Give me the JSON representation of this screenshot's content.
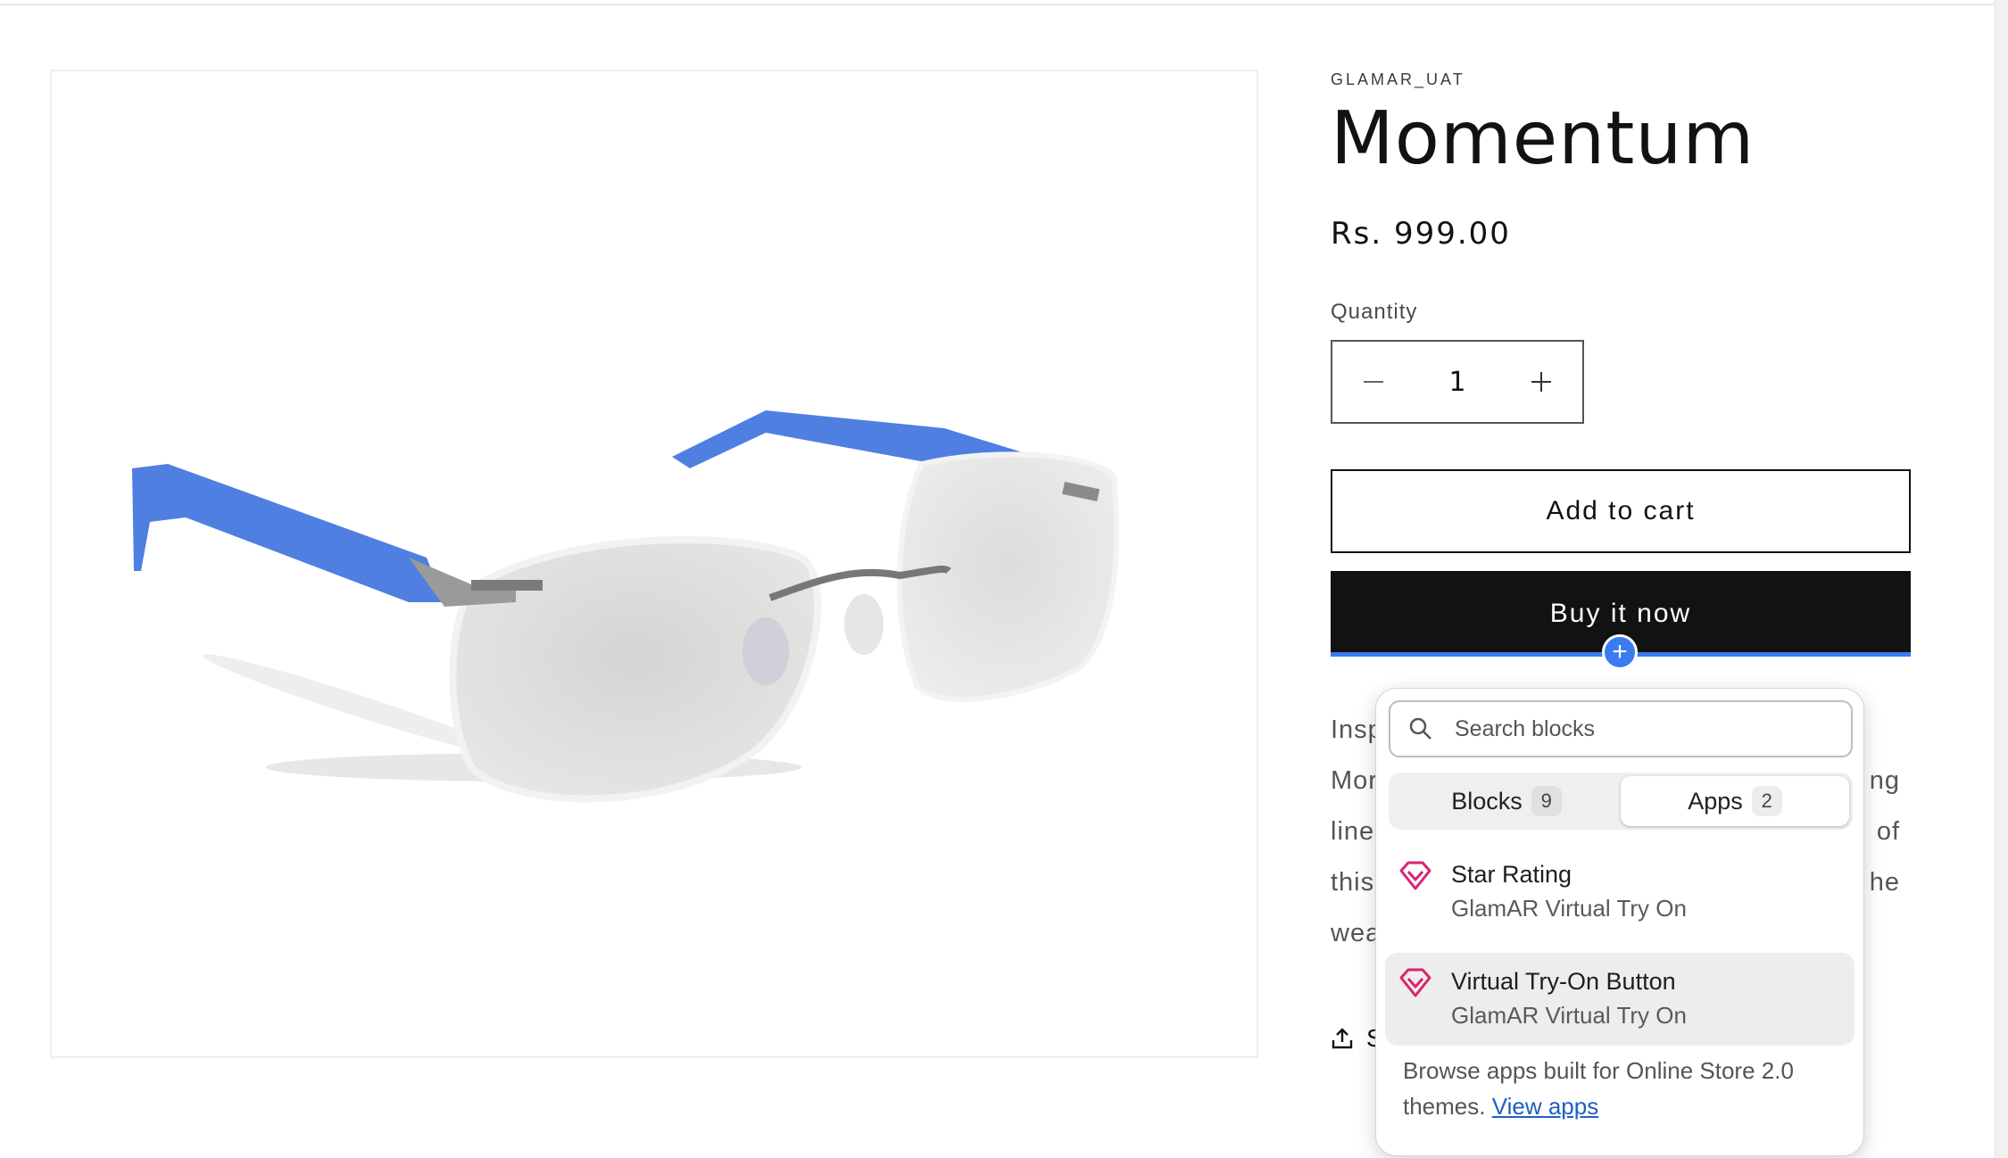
{
  "product": {
    "vendor": "GLAMAR_UAT",
    "title": "Momentum",
    "price": "Rs. 999.00",
    "quantity_label": "Quantity",
    "quantity_value": "1",
    "add_to_cart_label": "Add to cart",
    "buy_now_label": "Buy it now",
    "description_lines": [
      {
        "left": "Insp",
        "right": ""
      },
      {
        "left": "Mor",
        "right": "ng"
      },
      {
        "left": "line",
        "right": "of"
      },
      {
        "left": "this",
        "right": "he"
      },
      {
        "left": "wea",
        "right": ""
      }
    ],
    "share_label": "S"
  },
  "block_picker": {
    "search_placeholder": "Search blocks",
    "tabs": [
      {
        "label": "Blocks",
        "count": "9",
        "active": false
      },
      {
        "label": "Apps",
        "count": "2",
        "active": true
      }
    ],
    "items": [
      {
        "name": "Star Rating",
        "provider": "GlamAR Virtual Try On"
      },
      {
        "name": "Virtual Try-On Button",
        "provider": "GlamAR Virtual Try On"
      }
    ],
    "browse_text": "Browse apps built for Online Store 2.0 themes.",
    "browse_link": "View apps"
  },
  "colors": {
    "accent_blue": "#3b7bf0",
    "button_dark": "#121212",
    "app_icon": "#d6246e",
    "frame_blue": "#4f7fe0"
  },
  "icons": {
    "minus": "minus-icon",
    "plus": "plus-icon",
    "search": "search-icon",
    "share": "share-icon",
    "app": "glamar-diamond-icon"
  }
}
